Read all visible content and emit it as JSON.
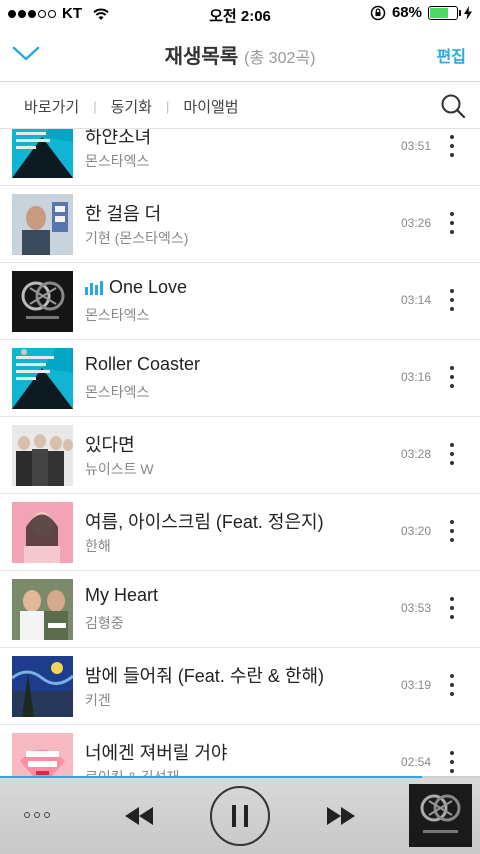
{
  "status": {
    "carrier": "KT",
    "time": "오전 2:06",
    "battery": "68%",
    "battery_level": 0.68
  },
  "header": {
    "title": "재생목록",
    "count": "(총 302곡)",
    "edit_label": "편집",
    "accent": "#2aa9e0"
  },
  "nav": {
    "items": [
      "바로가기",
      "동기화",
      "마이앨범"
    ]
  },
  "songs": [
    {
      "title": "하얀소녀",
      "artist": "몬스타엑스",
      "duration": "03:51",
      "art": "monsta-x-clan-cyan"
    },
    {
      "title": "한 걸음 더",
      "artist": "기현 (몬스타엑스)",
      "duration": "03:26",
      "art": "kihyun-portrait"
    },
    {
      "title": "One Love",
      "artist": "몬스타엑스",
      "duration": "03:14",
      "art": "monsta-x-dark",
      "playing": true
    },
    {
      "title": "Roller Coaster",
      "artist": "몬스타엑스",
      "duration": "03:16",
      "art": "monsta-x-clan-cyan"
    },
    {
      "title": "있다면",
      "artist": "뉴이스트 W",
      "duration": "03:28",
      "art": "nuest-w-group"
    },
    {
      "title": "여름, 아이스크림 (Feat. 정은지)",
      "artist": "한해",
      "duration": "03:20",
      "art": "hanhae-pink"
    },
    {
      "title": "My Heart",
      "artist": "김형중",
      "duration": "03:53",
      "art": "my-heart-duo"
    },
    {
      "title": "밤에 들어줘 (Feat. 수란 & 한해)",
      "artist": "키겐",
      "duration": "03:19",
      "art": "starry-night"
    },
    {
      "title": "너에겐 져버릴 거야",
      "artist": "로이킴 & 김선재",
      "duration": "02:54",
      "art": "story-about-pink"
    }
  ],
  "player": {
    "progress": 0.88
  }
}
